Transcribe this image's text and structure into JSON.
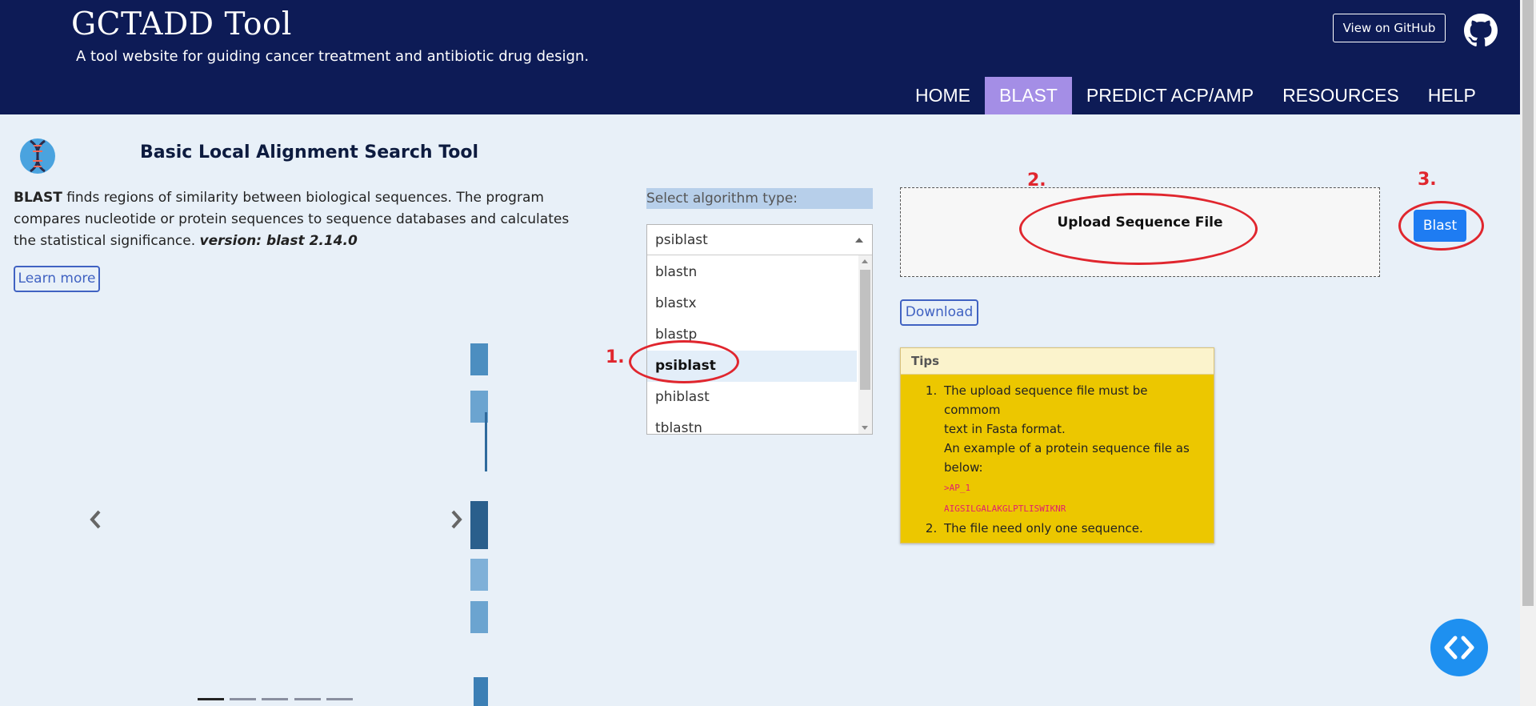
{
  "header": {
    "title": "GCTADD Tool",
    "subtitle": "A tool website for guiding cancer treatment and antibiotic drug design.",
    "github_label": "View on GitHub",
    "nav": [
      "HOME",
      "BLAST",
      "PREDICT ACP/AMP",
      "RESOURCES",
      "HELP"
    ],
    "active_nav": "BLAST",
    "background": "#0d1b56",
    "active_color": "#a48ee6"
  },
  "intro": {
    "title": "Basic Local Alignment Search Tool",
    "desc_bold": "BLAST",
    "desc": " finds regions of similarity between biological sequences. The program compares nucleotide or protein sequences to sequence databases and calculates the statistical significance. ",
    "version": "version: blast 2.14.0",
    "learn_more": "Learn more"
  },
  "algorithm": {
    "label": "Select algorithm type:",
    "selected": "psiblast",
    "options": [
      "blastn",
      "blastx",
      "blastp",
      "psiblast",
      "phiblast",
      "tblastn"
    ]
  },
  "upload": {
    "label": "Upload Sequence File",
    "download_label": "Download",
    "blast_label": "Blast"
  },
  "tips": {
    "header": "Tips",
    "item1_line1": "The upload sequence file must be commom",
    "item1_line2": "text in Fasta format.",
    "item1_line3": "An example of a protein sequence file as",
    "item1_line4": "below:",
    "example_id": ">AP_1",
    "example_seq": "AIGSILGALAKGLPTLISWIKNR",
    "item2": "The file need only one sequence."
  },
  "annotations": {
    "step1": "1.",
    "step2": "2.",
    "step3": "3."
  },
  "accent": "#1e7cf2"
}
